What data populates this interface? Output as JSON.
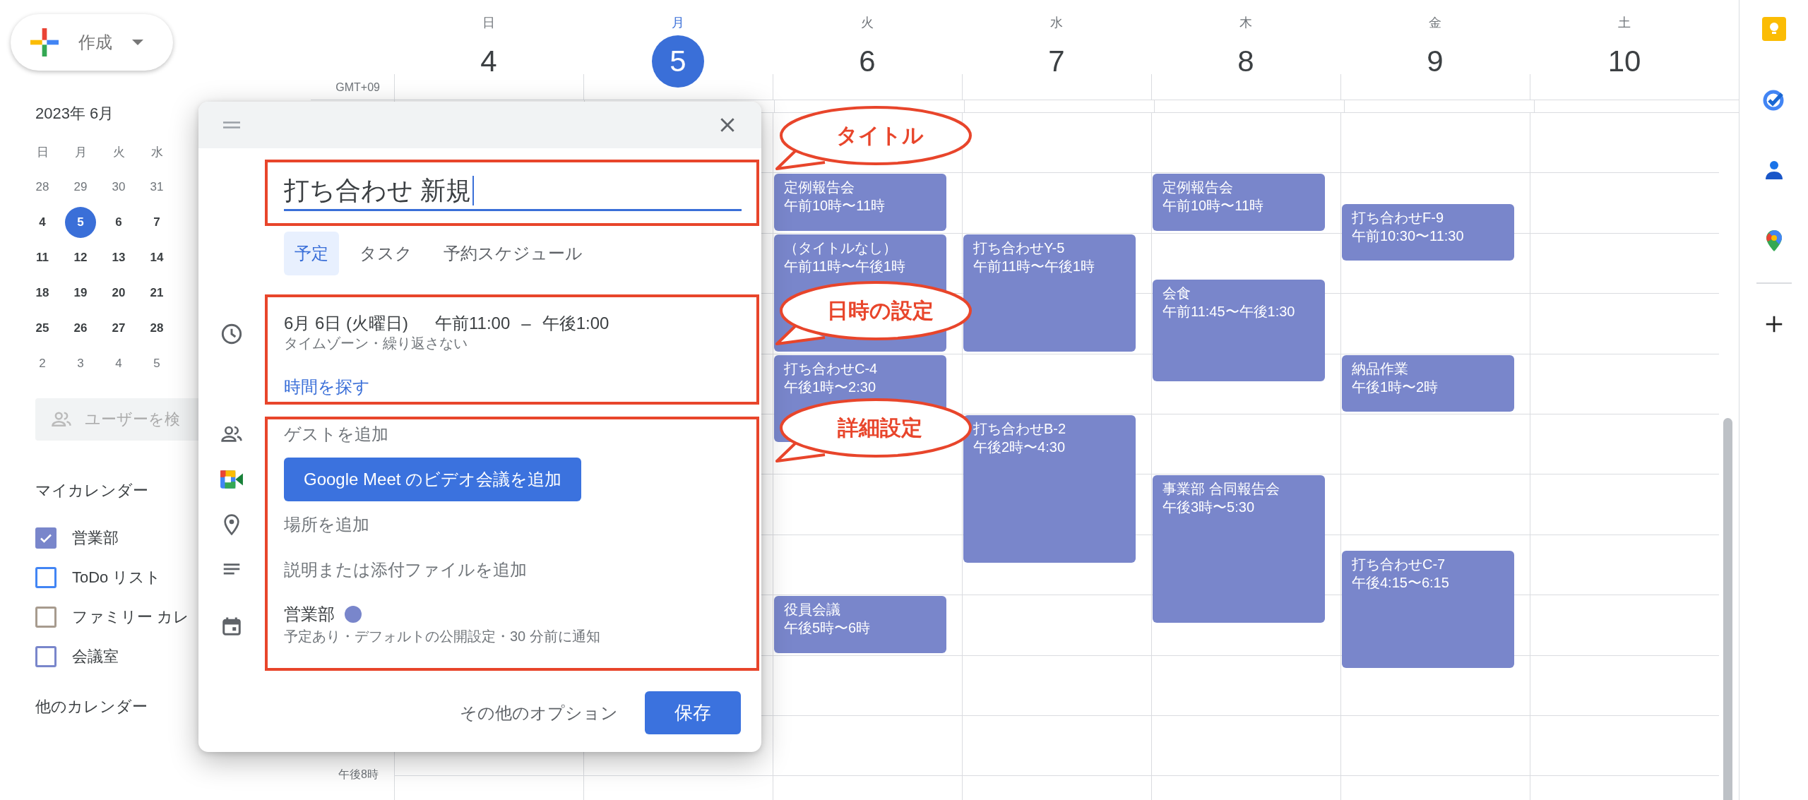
{
  "create_button": {
    "label": "作成"
  },
  "mini_calendar": {
    "title": "2023年 6月",
    "weekdays": [
      "日",
      "月",
      "火",
      "水"
    ],
    "weeks": [
      [
        {
          "day": "28",
          "muted": true,
          "selected": false
        },
        {
          "day": "29",
          "muted": true,
          "selected": false
        },
        {
          "day": "30",
          "muted": true,
          "selected": false
        },
        {
          "day": "31",
          "muted": true,
          "selected": false
        }
      ],
      [
        {
          "day": "4",
          "muted": false,
          "selected": false
        },
        {
          "day": "5",
          "muted": false,
          "selected": true
        },
        {
          "day": "6",
          "muted": false,
          "selected": false
        },
        {
          "day": "7",
          "muted": false,
          "selected": false
        }
      ],
      [
        {
          "day": "11",
          "muted": false,
          "selected": false
        },
        {
          "day": "12",
          "muted": false,
          "selected": false
        },
        {
          "day": "13",
          "muted": false,
          "selected": false
        },
        {
          "day": "14",
          "muted": false,
          "selected": false
        }
      ],
      [
        {
          "day": "18",
          "muted": false,
          "selected": false
        },
        {
          "day": "19",
          "muted": false,
          "selected": false
        },
        {
          "day": "20",
          "muted": false,
          "selected": false
        },
        {
          "day": "21",
          "muted": false,
          "selected": false
        }
      ],
      [
        {
          "day": "25",
          "muted": false,
          "selected": false
        },
        {
          "day": "26",
          "muted": false,
          "selected": false
        },
        {
          "day": "27",
          "muted": false,
          "selected": false
        },
        {
          "day": "28",
          "muted": false,
          "selected": false
        }
      ],
      [
        {
          "day": "2",
          "muted": true,
          "selected": false
        },
        {
          "day": "3",
          "muted": true,
          "selected": false
        },
        {
          "day": "4",
          "muted": true,
          "selected": false
        },
        {
          "day": "5",
          "muted": true,
          "selected": false
        }
      ]
    ]
  },
  "people_search": {
    "placeholder": "ユーザーを検"
  },
  "my_calendars": {
    "title": "マイカレンダー",
    "items": [
      {
        "label": "営業部",
        "checked": true,
        "color": "#7986cb"
      },
      {
        "label": "ToDo リスト",
        "checked": false,
        "color": "#4285f4"
      },
      {
        "label": "ファミリー カレ",
        "checked": false,
        "color": "#a79b8e"
      },
      {
        "label": "会議室",
        "checked": false,
        "color": "#7986cb"
      }
    ]
  },
  "other_calendars": {
    "title": "他のカレンダー"
  },
  "timezone": "GMT+09",
  "hour_labels": [
    "午後8時"
  ],
  "days": [
    {
      "weekday": "日",
      "date": "4",
      "selected": false
    },
    {
      "weekday": "月",
      "date": "5",
      "selected": true
    },
    {
      "weekday": "火",
      "date": "6",
      "selected": false,
      "events": [
        {
          "title": "定例報告会",
          "time": "午前10時〜11時"
        },
        {
          "title": "（タイトルなし）",
          "time": "午前11時〜午後1時"
        },
        {
          "title": "打ち合わせC-4",
          "time": "午後1時〜2:30"
        },
        {
          "title": "役員会議",
          "time": "午後5時〜6時"
        }
      ]
    },
    {
      "weekday": "水",
      "date": "7",
      "selected": false,
      "events": [
        {
          "title": "打ち合わせY-5",
          "time": "午前11時〜午後1時"
        },
        {
          "title": "打ち合わせB-2",
          "time": "午後2時〜4:30"
        }
      ]
    },
    {
      "weekday": "木",
      "date": "8",
      "selected": false,
      "events": [
        {
          "title": "定例報告会",
          "time": "午前10時〜11時"
        },
        {
          "title": "会食",
          "time": "午前11:45〜午後1:30"
        },
        {
          "title": "事業部 合同報告会",
          "time": "午後3時〜5:30"
        }
      ]
    },
    {
      "weekday": "金",
      "date": "9",
      "selected": false,
      "events": [
        {
          "title": "打ち合わせF-9",
          "time": "午前10:30〜11:30"
        },
        {
          "title": "納品作業",
          "time": "午後1時〜2時"
        },
        {
          "title": "打ち合わせC-7",
          "time": "午後4:15〜6:15"
        }
      ]
    },
    {
      "weekday": "土",
      "date": "10",
      "selected": false
    }
  ],
  "dialog": {
    "title_input": {
      "value": "打ち合わせ 新規"
    },
    "tabs": [
      {
        "label": "予定",
        "selected": true
      },
      {
        "label": "タスク",
        "selected": false
      },
      {
        "label": "予約スケジュール",
        "selected": false
      }
    ],
    "date": "6月 6日 (火曜日)",
    "start_time": "午前11:00",
    "separator": "–",
    "end_time": "午後1:00",
    "recurrence": "タイムゾーン・繰り返さない",
    "find_time": "時間を探す",
    "guests": {
      "placeholder": "ゲストを追加"
    },
    "meet_button": "Google Meet のビデオ会議を追加",
    "location": {
      "placeholder": "場所を追加"
    },
    "description": {
      "placeholder": "説明または添付ファイルを追加"
    },
    "calendar": {
      "name": "営業部",
      "color": "#7986cb"
    },
    "calendar_details": "予定あり・デフォルトの公開設定・30 分前に通知",
    "more_options": "その他のオプション",
    "save_button": "保存"
  },
  "annotations": [
    {
      "label": "タイトル"
    },
    {
      "label": "日時の設定"
    },
    {
      "label": "詳細設定"
    }
  ]
}
